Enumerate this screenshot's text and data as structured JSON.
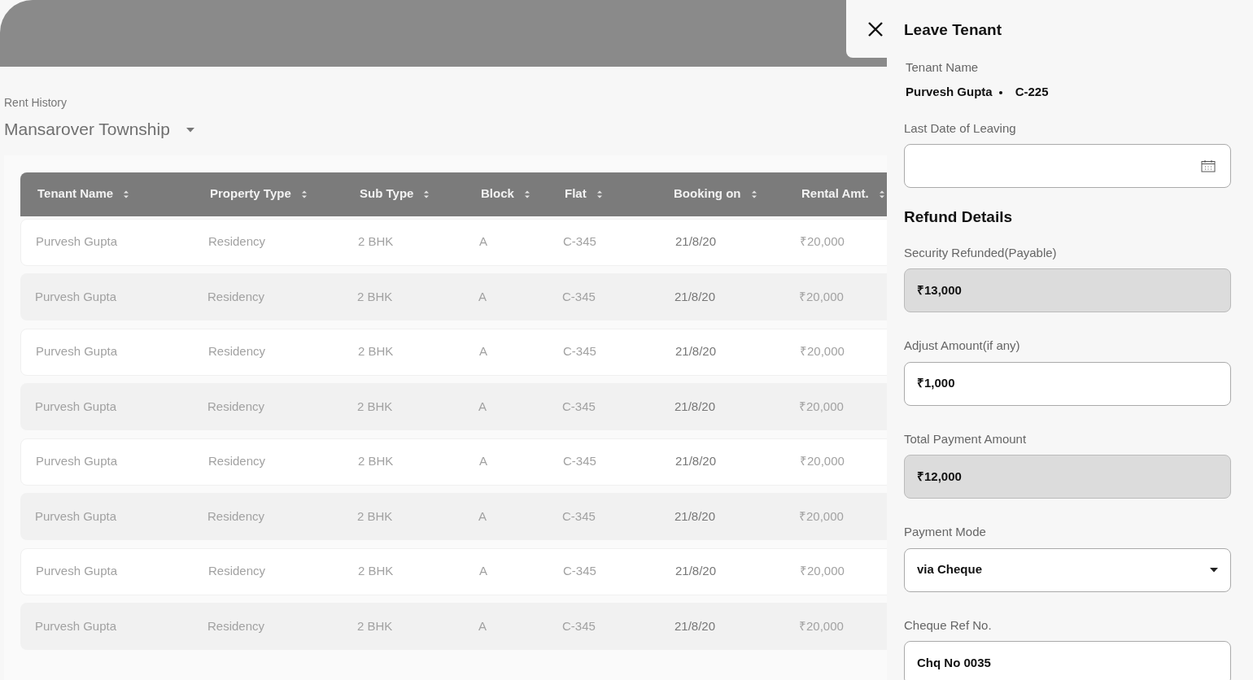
{
  "page": {
    "subtitle": "Rent History",
    "title": "Mansarover Township"
  },
  "table": {
    "columns": [
      "Tenant Name",
      "Property Type",
      "Sub Type",
      "Block",
      "Flat",
      "Booking on",
      "Rental Amt."
    ],
    "rows": [
      [
        "Purvesh Gupta",
        "Residency",
        "2 BHK",
        "A",
        "C-345",
        "21/8/20",
        "₹20,000"
      ],
      [
        "Purvesh Gupta",
        "Residency",
        "2 BHK",
        "A",
        "C-345",
        "21/8/20",
        "₹20,000"
      ],
      [
        "Purvesh Gupta",
        "Residency",
        "2 BHK",
        "A",
        "C-345",
        "21/8/20",
        "₹20,000"
      ],
      [
        "Purvesh Gupta",
        "Residency",
        "2 BHK",
        "A",
        "C-345",
        "21/8/20",
        "₹20,000"
      ],
      [
        "Purvesh Gupta",
        "Residency",
        "2 BHK",
        "A",
        "C-345",
        "21/8/20",
        "₹20,000"
      ],
      [
        "Purvesh Gupta",
        "Residency",
        "2 BHK",
        "A",
        "C-345",
        "21/8/20",
        "₹20,000"
      ],
      [
        "Purvesh Gupta",
        "Residency",
        "2 BHK",
        "A",
        "C-345",
        "21/8/20",
        "₹20,000"
      ],
      [
        "Purvesh Gupta",
        "Residency",
        "2 BHK",
        "A",
        "C-345",
        "21/8/20",
        "₹20,000"
      ]
    ]
  },
  "drawer": {
    "title": "Leave Tenant",
    "tenant_label": "Tenant Name",
    "tenant_name": "Purvesh Gupta",
    "unit": "C-225",
    "fields": [
      {
        "kind": "date",
        "label": "Last Date of Leaving"
      },
      {
        "kind": "heading",
        "label": "Refund Details"
      },
      {
        "kind": "readonly",
        "label": "Security Refunded(Payable)",
        "value": "₹13,000"
      },
      {
        "kind": "input",
        "label": "Adjust Amount(if any)",
        "value": "₹1,000"
      },
      {
        "kind": "readonly",
        "label": "Total Payment Amount",
        "value": "₹12,000"
      },
      {
        "kind": "select",
        "label": "Payment Mode",
        "value": "via Cheque"
      },
      {
        "kind": "input",
        "label": "Cheque Ref No.",
        "value": "Chq No 0035"
      }
    ]
  }
}
